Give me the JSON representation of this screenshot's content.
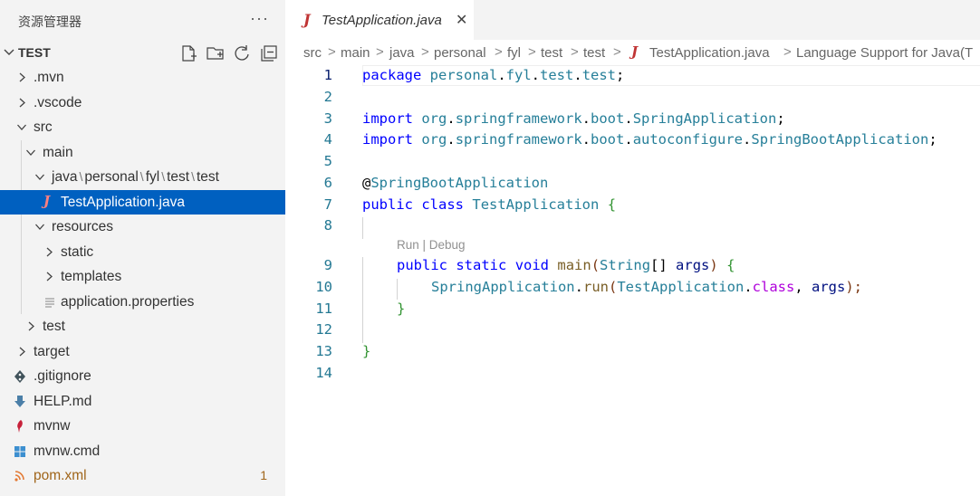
{
  "sidebar": {
    "title": "资源管理器",
    "more_label": "···",
    "section_title": "TEST",
    "actions": [
      "new-file-icon",
      "new-folder-icon",
      "refresh-icon",
      "collapse-all-icon"
    ]
  },
  "tree": [
    {
      "label": ".mvn"
    },
    {
      "label": ".vscode"
    },
    {
      "label": "src"
    },
    {
      "label": "main"
    },
    {
      "segments": [
        "java",
        "personal",
        "fyl",
        "test",
        "test"
      ],
      "sep": "\\"
    },
    {
      "label": "TestApplication.java",
      "icon": "J"
    },
    {
      "label": "resources"
    },
    {
      "label": "static"
    },
    {
      "label": "templates"
    },
    {
      "label": "application.properties"
    },
    {
      "label": "test"
    },
    {
      "label": "target"
    },
    {
      "label": ".gitignore"
    },
    {
      "label": "HELP.md"
    },
    {
      "label": "mvnw"
    },
    {
      "label": "mvnw.cmd"
    },
    {
      "label": "pom.xml",
      "badge": "1"
    }
  ],
  "editor": {
    "tab": {
      "icon": "J",
      "label": "TestApplication.java",
      "close": "✕"
    },
    "breadcrumb": [
      "src",
      "main",
      "java",
      "personal",
      "fyl",
      "test",
      "test",
      "TestApplication.java",
      "Language Support for Java(T"
    ],
    "breadcrumb_sep": ">",
    "line_numbers": [
      "1",
      "2",
      "3",
      "4",
      "5",
      "6",
      "7",
      "8",
      "9",
      "10",
      "11",
      "12",
      "13",
      "14"
    ],
    "codelens": "Run | Debug",
    "code": {
      "l1": {
        "kw": "package",
        "p1": "personal",
        "p2": "fyl",
        "p3": "test",
        "p4": "test",
        "end": ";"
      },
      "l3": {
        "kw": "import",
        "p1": "org",
        "p2": "springframework",
        "p3": "boot",
        "c": "SpringApplication",
        "end": ";"
      },
      "l4": {
        "kw": "import",
        "p1": "org",
        "p2": "springframework",
        "p3": "boot",
        "p4": "autoconfigure",
        "c": "SpringBootApplication",
        "end": ";"
      },
      "l6": {
        "at": "@",
        "c": "SpringBootApplication"
      },
      "l7": {
        "kw1": "public",
        "kw2": "class",
        "c": "TestApplication",
        "br": "{"
      },
      "l9": {
        "kw1": "public",
        "kw2": "static",
        "kw3": "void",
        "fn": "main",
        "op": "(",
        "c": "String",
        "arr": "[]",
        "par": "args",
        "cp": ")",
        "br": "{"
      },
      "l10": {
        "c": "SpringApplication",
        "dot": ".",
        "fn": "run",
        "op": "(",
        "c2": "TestApplication",
        "dot2": ".",
        "kw": "class",
        "comma": ", ",
        "par": "args",
        "end": ");"
      },
      "l11": {
        "br": "}"
      },
      "l13": {
        "br": "}"
      }
    }
  }
}
